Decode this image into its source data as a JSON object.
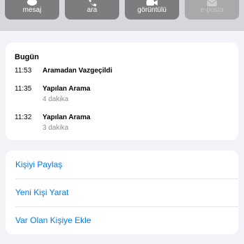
{
  "header": {
    "actions": [
      {
        "label": "mesaj",
        "icon": "message-icon"
      },
      {
        "label": "ara",
        "icon": "phone-icon"
      },
      {
        "label": "görüntülü",
        "icon": "video-icon"
      },
      {
        "label": "e-posta",
        "icon": "mail-icon",
        "disabled": true
      }
    ]
  },
  "recents": {
    "title": "Bugün",
    "entries": [
      {
        "time": "11:53",
        "type": "Aramadan Vazgeçildi",
        "duration": ""
      },
      {
        "time": "11:35",
        "type": "Yapılan Arama",
        "duration": "4 dakika"
      },
      {
        "time": "11:32",
        "type": "Yapılan Arama",
        "duration": "3 dakika"
      }
    ]
  },
  "contact_actions": {
    "share": "Kişiyi Paylaş",
    "new_contact": "Yeni Kişi Yarat",
    "add_existing": "Var Olan Kişiye Ekle"
  },
  "colors": {
    "accent": "#007aff",
    "background": "#f2f2f7",
    "action_button": "#7d7d80"
  }
}
